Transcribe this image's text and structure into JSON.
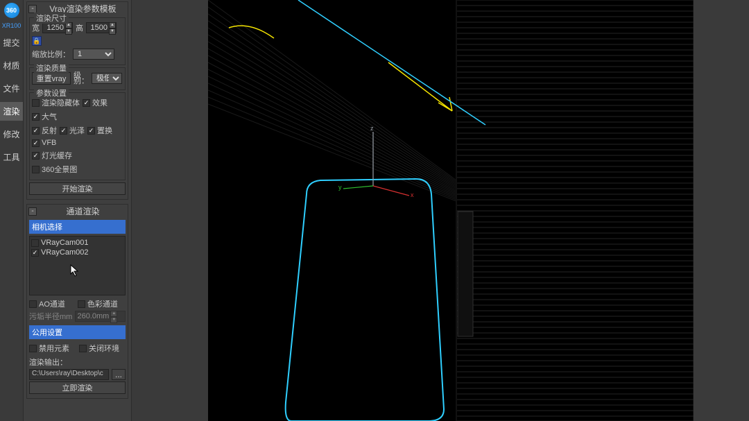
{
  "leftnav": {
    "title": "XR100",
    "items": [
      "提交",
      "材质",
      "文件",
      "渲染",
      "修改",
      "工具"
    ],
    "active_index": 3
  },
  "rollout_main": {
    "title": "Vray渲染参数模板",
    "size_group": {
      "title": "渲染尺寸",
      "width_label": "宽",
      "width_value": "1250",
      "height_label": "高",
      "height_value": "1500",
      "scale_label": "缩放比例：",
      "scale_value": "1"
    },
    "quality_group": {
      "title": "渲染质量",
      "reset_label": "重置vray",
      "level_label_top": "级",
      "level_label_bottom": "别：",
      "level_value": "极低"
    },
    "params_group": {
      "title": "参数设置",
      "checks": {
        "hide": {
          "label": "渲染隐藏体",
          "checked": false
        },
        "effect": {
          "label": "效果",
          "checked": true
        },
        "atmos": {
          "label": "大气",
          "checked": true
        },
        "reflect": {
          "label": "反射",
          "checked": true
        },
        "gloss": {
          "label": "光泽",
          "checked": true
        },
        "replace": {
          "label": "置换",
          "checked": true
        },
        "vfb": {
          "label": "VFB",
          "checked": true
        },
        "lightcache": {
          "label": "灯光缓存",
          "checked": true
        },
        "pano360": {
          "label": "360全景图",
          "checked": false
        }
      }
    },
    "start_render": "开始渲染"
  },
  "rollout_channel": {
    "title": "通道渲染",
    "camera_header": "相机选择",
    "cameras": [
      {
        "name": "VRayCam001",
        "checked": false
      },
      {
        "name": "VRayCam002",
        "checked": true
      }
    ],
    "ao_label": "AO通道",
    "color_label": "色彩通道",
    "radius_label": "污垢半径mm",
    "radius_value": "260.0mm",
    "common_header": "公用设置",
    "disable_elem_label": "禁用元素",
    "close_env_label": "关闭环境",
    "output_label": "渲染输出：",
    "output_path": "C:\\Users\\ray\\Desktop\\c",
    "render_now": "立即渲染"
  }
}
